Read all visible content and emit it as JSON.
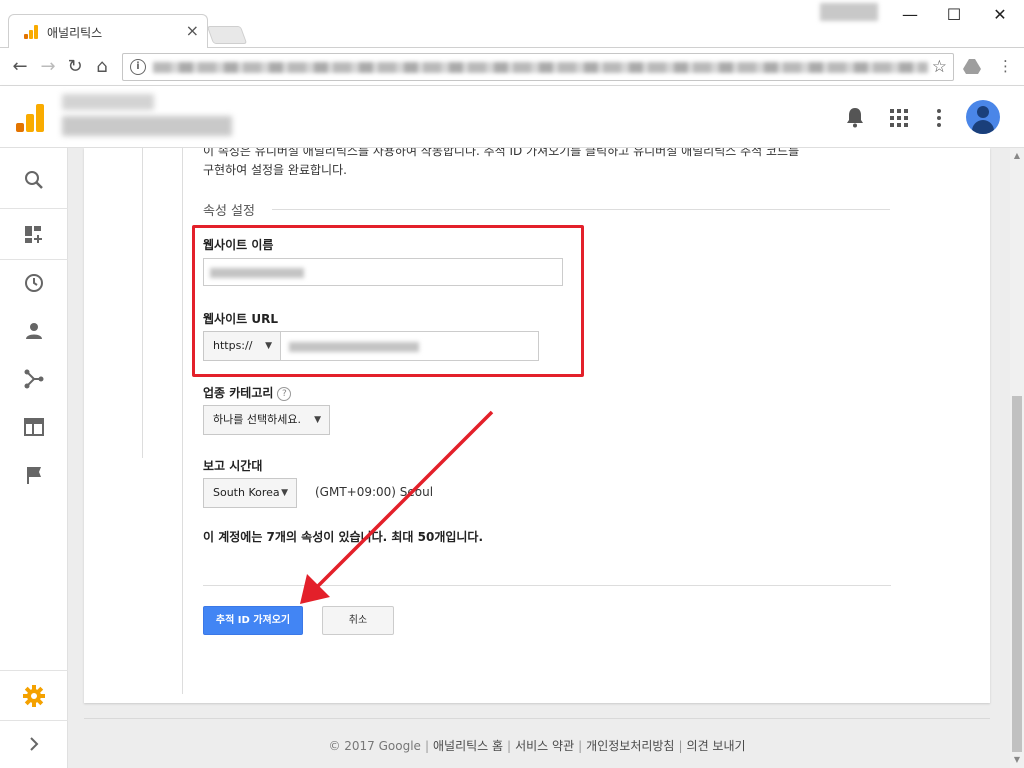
{
  "browser": {
    "tab_title": "애널리틱스",
    "tab_close": "×",
    "nav_back": "←",
    "nav_forward": "→",
    "nav_reload": "↻",
    "nav_home": "⌂",
    "window_minimize": "—",
    "window_maximize": "☐",
    "window_close": "✕"
  },
  "form": {
    "intro_line1": "이 속성은 유니버설 애널리틱스를 사용하여 작동합니다. 추적 ID 가져오기를 클릭하고 유니버설 애널리틱스 추적 코드를",
    "intro_line2": "구현하여 설정을 완료합니다.",
    "section_title": "속성 설정",
    "website_name_label": "웹사이트 이름",
    "website_url_label": "웹사이트 URL",
    "protocol_value": "https://",
    "industry_label": "업종 카테고리",
    "industry_help": "?",
    "industry_value": "하나를 선택하세요.",
    "timezone_label": "보고 시간대",
    "country_value": "South Korea",
    "timezone_value": "(GMT+09:00) Seoul",
    "property_info": "이 계정에는 7개의 속성이 있습니다. 최대 50개입니다.",
    "get_tracking_id_button": "추적 ID 가져오기",
    "cancel_button": "취소"
  },
  "footer": {
    "copyright": "© 2017 Google",
    "links": [
      "애널리틱스 홈",
      "서비스 약관",
      "개인정보처리방침",
      "의견 보내기"
    ]
  },
  "colors": {
    "accent": "#4285f4",
    "highlight": "#e3202a",
    "logo_orange": "#f9ab00",
    "logo_dark": "#e37400",
    "settings_orange": "#f4a100"
  }
}
